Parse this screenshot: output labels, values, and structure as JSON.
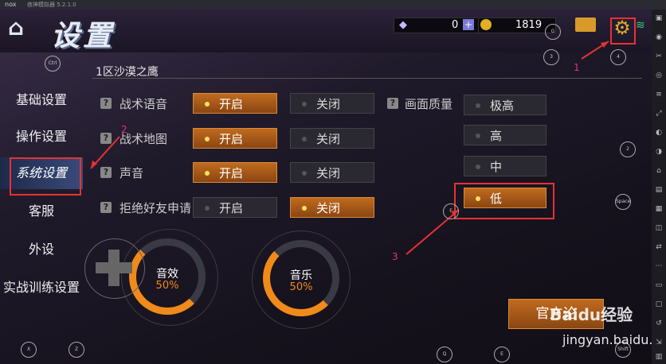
{
  "emulator": {
    "brand": "nox",
    "window_title": "夜神模拟器 5.2.1.0"
  },
  "header": {
    "title": "设置",
    "gems": "0",
    "gold": "1819",
    "plus": "+"
  },
  "zone": "1区沙漠之鹰",
  "left_nav": [
    "基础设置",
    "操作设置",
    "系统设置",
    "客服",
    "外设",
    "实战训练设置"
  ],
  "options": [
    {
      "label": "战术语音",
      "on": "开启",
      "off": "关闭",
      "selected": "on"
    },
    {
      "label": "战术地图",
      "on": "开启",
      "off": "关闭",
      "selected": "on"
    },
    {
      "label": "声音",
      "on": "开启",
      "off": "关闭",
      "selected": "on"
    },
    {
      "label": "拒绝好友申请",
      "on": "开启",
      "off": "关闭",
      "selected": "off"
    }
  ],
  "quality": {
    "label": "画面质量",
    "levels": [
      "极高",
      "高",
      "中",
      "低"
    ],
    "selected": "低"
  },
  "sfx": {
    "label": "音效",
    "value": "50%"
  },
  "music": {
    "label": "音乐",
    "value": "50%"
  },
  "official_button": "官方论",
  "annotations": [
    "1",
    "2",
    "3"
  ],
  "watermark": {
    "brand": "Baidu经验",
    "url": "jingyan.baidu.com"
  },
  "key_hints": [
    "Ctrl",
    "3",
    "4",
    "2",
    "Space",
    "X",
    "Z",
    "Q",
    "E",
    "Shift",
    "F",
    "G"
  ],
  "colors": {
    "accent_orange": "#c06b1e",
    "highlight_red": "#e53333",
    "annotation_pink": "#e0338a"
  }
}
